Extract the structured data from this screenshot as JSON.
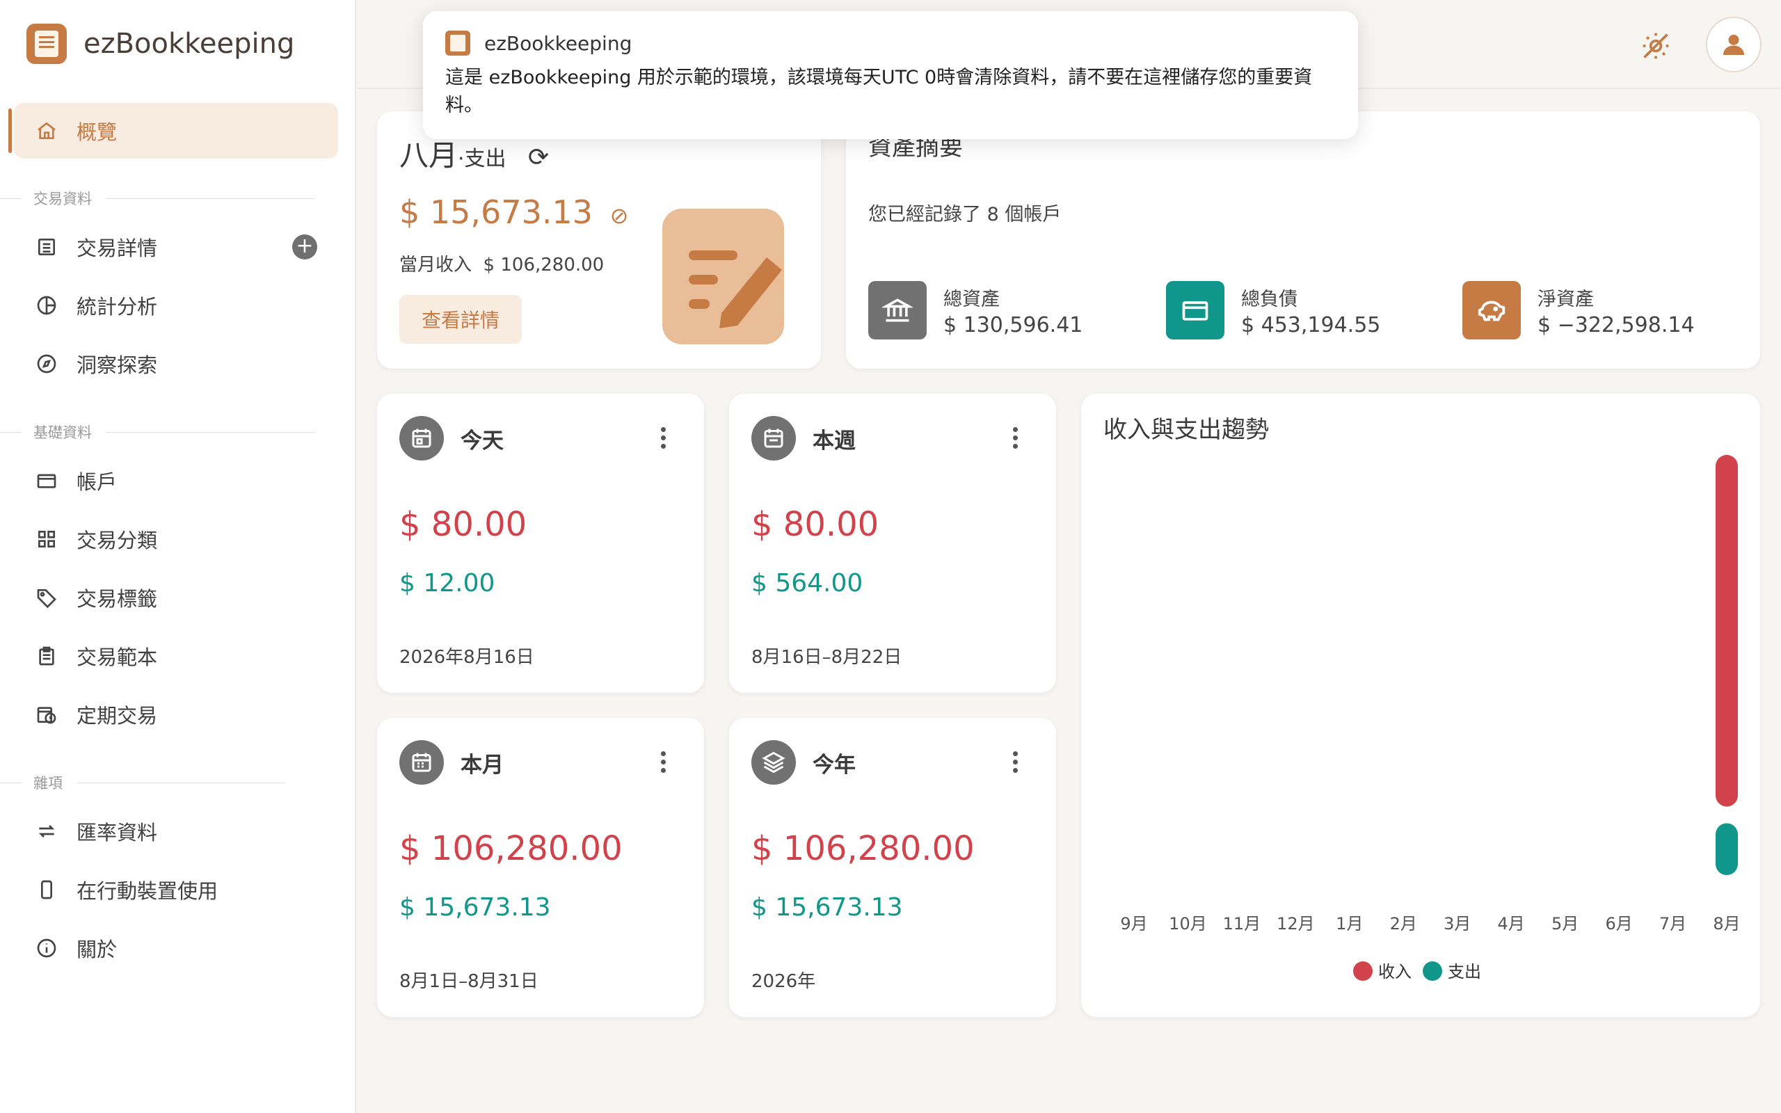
{
  "brand": {
    "name": "ezBookkeeping"
  },
  "sidebar": {
    "overview": "概覽",
    "sections": {
      "transactions": "交易資料",
      "basic": "基礎資料",
      "misc": "雜項"
    },
    "items": {
      "transaction_details": "交易詳情",
      "statistics": "統計分析",
      "insights": "洞察探索",
      "accounts": "帳戶",
      "categories": "交易分類",
      "tags": "交易標籤",
      "templates": "交易範本",
      "scheduled": "定期交易",
      "exchange_rates": "匯率資料",
      "mobile": "在行動裝置使用",
      "about": "關於"
    }
  },
  "toast": {
    "app": "ezBookkeeping",
    "message": "這是 ezBookkeeping 用於示範的環境，該環境每天UTC 0時會清除資料，請不要在這裡儲存您的重要資料。"
  },
  "monthly": {
    "month": "八月",
    "type": "·支出",
    "amount": "$ 15,673.13",
    "income_label": "當月收入",
    "income_value": "$ 106,280.00",
    "detail_button": "查看詳情"
  },
  "assets": {
    "title": "資產摘要",
    "subtitle": "您已經記錄了 8 個帳戶",
    "total_assets_label": "總資產",
    "total_assets_value": "$ 130,596.41",
    "total_liabilities_label": "總負債",
    "total_liabilities_value": "$ 453,194.55",
    "net_assets_label": "淨資產",
    "net_assets_value": "$ −322,598.14"
  },
  "periods": {
    "today": {
      "title": "今天",
      "expense": "$ 80.00",
      "income": "$ 12.00",
      "date": "2026年8月16日"
    },
    "week": {
      "title": "本週",
      "expense": "$ 80.00",
      "income": "$ 564.00",
      "date": "8月16日–8月22日"
    },
    "month": {
      "title": "本月",
      "expense": "$ 106,280.00",
      "income": "$ 15,673.13",
      "date": "8月1日–8月31日"
    },
    "year": {
      "title": "今年",
      "expense": "$ 106,280.00",
      "income": "$ 15,673.13",
      "date": "2026年"
    }
  },
  "colors": {
    "accent": "#c67b45",
    "expense": "#d1424a",
    "income": "#10968a"
  },
  "chart_data": {
    "type": "bar",
    "title": "收入與支出趨勢",
    "categories": [
      "9月",
      "10月",
      "11月",
      "12月",
      "1月",
      "2月",
      "3月",
      "4月",
      "5月",
      "6月",
      "7月",
      "8月"
    ],
    "series": [
      {
        "name": "收入",
        "color": "#d1424a",
        "values": [
          0,
          0,
          0,
          0,
          0,
          0,
          0,
          0,
          0,
          0,
          0,
          106280
        ]
      },
      {
        "name": "支出",
        "color": "#10968a",
        "values": [
          0,
          0,
          0,
          0,
          0,
          0,
          0,
          0,
          0,
          0,
          0,
          15673.13
        ]
      }
    ],
    "legend": "bottom",
    "grid": false
  }
}
